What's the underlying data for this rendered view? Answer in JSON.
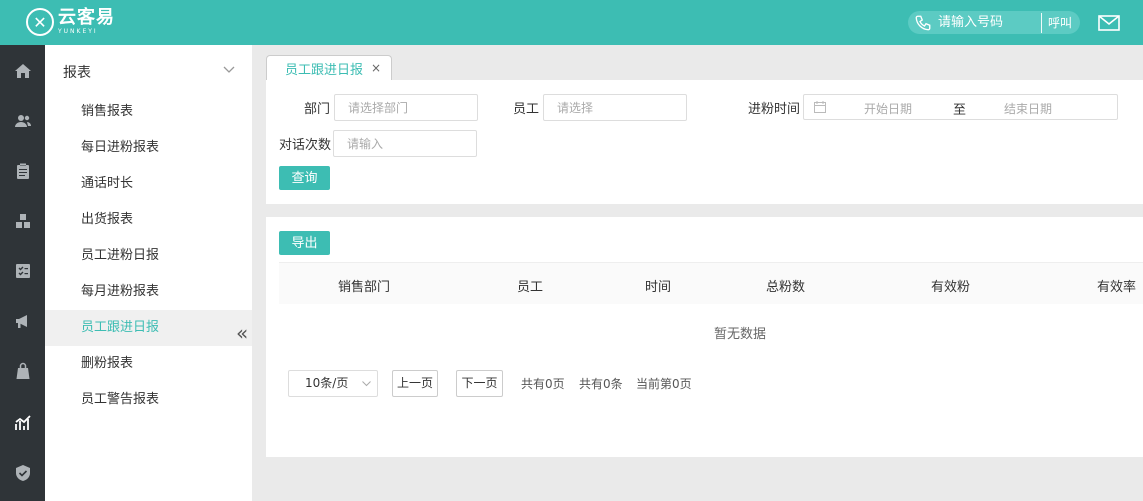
{
  "brand": {
    "logo_cn": "云客易",
    "logo_en": "YUNKEYI"
  },
  "topbar": {
    "phone_placeholder": "请输入号码",
    "call_label": "呼叫"
  },
  "iconbar": [
    "home-icon",
    "users-icon",
    "clipboard-icon",
    "cubes-icon",
    "checklist-icon",
    "megaphone-icon",
    "bag-icon",
    "report-chart-icon",
    "shield-icon"
  ],
  "menu": {
    "title": "报表",
    "items": [
      "销售报表",
      "每日进粉报表",
      "通话时长",
      "出货报表",
      "员工进粉日报",
      "每月进粉报表",
      "员工跟进日报",
      "删粉报表",
      "员工警告报表"
    ],
    "active_index": 6,
    "collapse_label": "«"
  },
  "tab": {
    "label": "员工跟进日报",
    "close": "×"
  },
  "filter": {
    "dept_label": "部门",
    "dept_placeholder": "请选择部门",
    "staff_label": "员工",
    "staff_placeholder": "请选择",
    "date_label": "进粉时间",
    "date_start": "开始日期",
    "date_to": "至",
    "date_end": "结束日期",
    "count_label": "对话次数",
    "count_placeholder": "请输入",
    "query_button": "查询"
  },
  "table": {
    "export_button": "导出",
    "columns": [
      "销售部门",
      "员工",
      "时间",
      "总粉数",
      "有效粉",
      "有效率"
    ],
    "empty_text": "暂无数据"
  },
  "pager": {
    "page_size": "10条/页",
    "prev": "上一页",
    "next": "下一页",
    "total_pages": "共有0页",
    "total_items": "共有0条",
    "current": "当前第0页"
  },
  "colors": {
    "accent": "#3dbdb3",
    "sidebar_dark": "#2f3438"
  }
}
